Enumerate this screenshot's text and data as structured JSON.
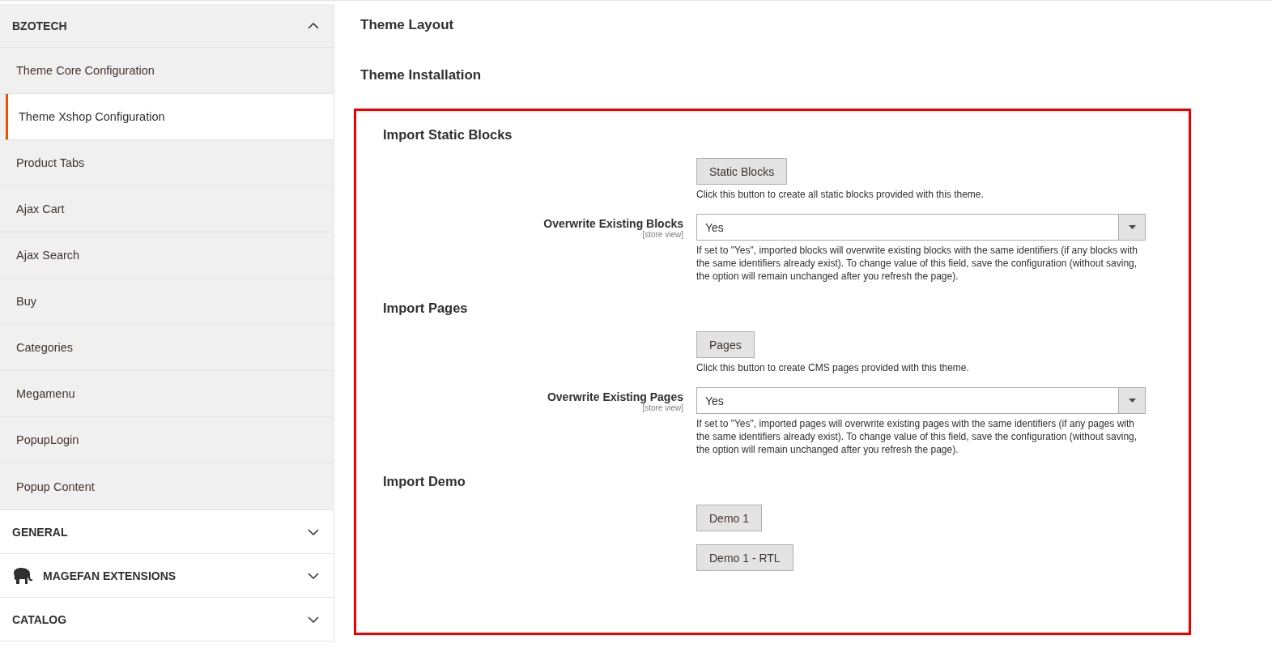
{
  "sidebar": {
    "groups": [
      {
        "title": "BZOTECH",
        "expanded": true,
        "items": [
          {
            "label": "Theme Core Configuration",
            "selected": false
          },
          {
            "label": "Theme Xshop Configuration",
            "selected": true
          },
          {
            "label": "Product Tabs",
            "selected": false
          },
          {
            "label": "Ajax Cart",
            "selected": false
          },
          {
            "label": "Ajax Search",
            "selected": false
          },
          {
            "label": "Buy",
            "selected": false
          },
          {
            "label": "Categories",
            "selected": false
          },
          {
            "label": "Megamenu",
            "selected": false
          },
          {
            "label": "PopupLogin",
            "selected": false
          },
          {
            "label": "Popup Content",
            "selected": false
          }
        ]
      },
      {
        "title": "GENERAL",
        "expanded": false
      },
      {
        "title": "MAGEFAN EXTENSIONS",
        "expanded": false,
        "kind": "with-icon"
      },
      {
        "title": "CATALOG",
        "expanded": false
      }
    ]
  },
  "sections": [
    {
      "title": "Theme Layout"
    },
    {
      "title": "Theme Installation"
    }
  ],
  "installation": {
    "groups": [
      {
        "title": "Import Static Blocks",
        "rows": [
          {
            "kind": "button",
            "label": "Static Blocks",
            "note": "Click this button to create all static blocks provided with this theme."
          },
          {
            "kind": "select",
            "label": "Overwrite Existing Blocks",
            "scope": "[store view]",
            "value": "Yes",
            "note": "If set to \"Yes\", imported blocks will overwrite existing blocks with the same identifiers (if any blocks with the same identifiers already exist). To change value of this field, save the configuration (without saving, the option will remain unchanged after you refresh the page)."
          }
        ]
      },
      {
        "title": "Import Pages",
        "rows": [
          {
            "kind": "button",
            "label": "Pages",
            "note": "Click this button to create CMS pages provided with this theme."
          },
          {
            "kind": "select",
            "label": "Overwrite Existing Pages",
            "scope": "[store view]",
            "value": "Yes",
            "note": "If set to \"Yes\", imported pages will overwrite existing pages with the same identifiers (if any pages with the same identifiers already exist). To change value of this field, save the configuration (without saving, the option will remain unchanged after you refresh the page)."
          }
        ]
      },
      {
        "title": "Import Demo",
        "rows": [
          {
            "kind": "button",
            "label": "Demo 1"
          },
          {
            "kind": "button",
            "label": "Demo 1 - RTL"
          }
        ]
      }
    ]
  }
}
